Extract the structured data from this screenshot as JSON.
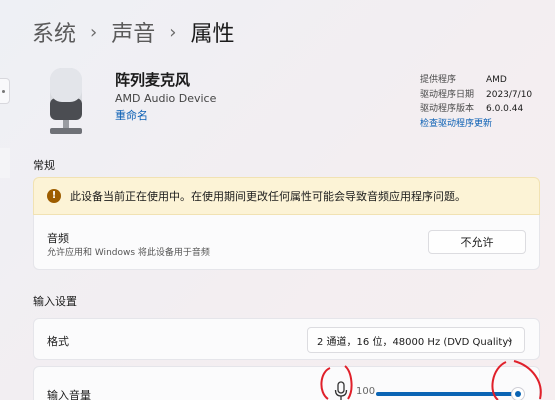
{
  "breadcrumb": [
    "系统",
    "声音",
    "属性"
  ],
  "device": {
    "name": "阵列麦克风",
    "subtitle": "AMD Audio Device",
    "rename_label": "重命名"
  },
  "driver": {
    "provider_label": "提供程序",
    "provider_value": "AMD",
    "date_label": "驱动程序日期",
    "date_value": "2023/7/10",
    "version_label": "驱动程序版本",
    "version_value": "6.0.0.44",
    "update_link": "检查驱动程序更新"
  },
  "general": {
    "section_title": "常规",
    "warning_text": "此设备当前正在使用中。在使用期间更改任何属性可能会导致音频应用程序问题。",
    "audio_title": "音频",
    "audio_desc": "允许应用和 Windows 将此设备用于音频",
    "audio_button": "不允许"
  },
  "input_settings": {
    "section_title": "输入设置",
    "format_label": "格式",
    "format_value": "2 通道，16 位，48000 Hz (DVD Quality)",
    "volume_label": "输入音量",
    "volume_value": "100",
    "volume_level": 100
  },
  "icons": {
    "warning": "warning-icon",
    "chevron": "chevron-down-icon",
    "microphone": "microphone-icon",
    "device": "microphone-device-icon"
  },
  "colors": {
    "accent": "#0a64b4",
    "link": "#0a5fb4",
    "warning_bg": "#fcf3d6",
    "warning_icon": "#9d5d00",
    "annotation": "#e0202a"
  }
}
